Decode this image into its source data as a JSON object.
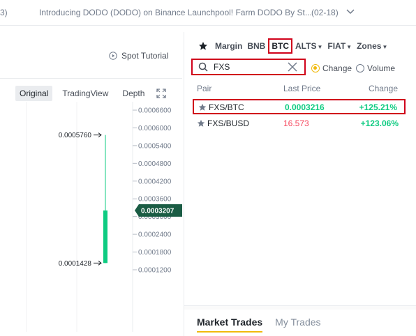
{
  "announcement": {
    "left_fragment": "3)",
    "text": "Introducing DODO (DODO) on Binance Launchpool! Farm DODO By St...",
    "date": "(02-18)"
  },
  "chart_panel": {
    "tutorial_label": "Spot Tutorial",
    "tabs": [
      {
        "label": "Original",
        "active": true
      },
      {
        "label": "TradingView",
        "active": false
      },
      {
        "label": "Depth",
        "active": false
      }
    ],
    "price_axis": [
      "0.0006600",
      "0.0006000",
      "0.0005400",
      "0.0004800",
      "0.0004200",
      "0.0003600",
      "0.0003000",
      "0.0002400",
      "0.0001800",
      "0.0001200"
    ],
    "high_label": "0.0005760",
    "low_label": "0.0001428",
    "current_price": "0.0003207",
    "candle": {
      "open": 0.0001428,
      "close": 0.0003207,
      "high": 0.000576,
      "low": 0.0001428
    },
    "colors": {
      "up": "#0ecb81",
      "current_tag": "#1a5c44"
    }
  },
  "market_panel": {
    "categories": [
      {
        "label": "Margin",
        "caret": false,
        "highlight": false
      },
      {
        "label": "BNB",
        "caret": false,
        "highlight": false
      },
      {
        "label": "BTC",
        "caret": false,
        "highlight": true
      },
      {
        "label": "ALTS",
        "caret": true,
        "highlight": false
      },
      {
        "label": "FIAT",
        "caret": true,
        "highlight": false
      },
      {
        "label": "Zones",
        "caret": true,
        "highlight": false
      }
    ],
    "search": {
      "value": "FXS",
      "placeholder": "Search"
    },
    "sort_options": [
      {
        "label": "Change",
        "selected": true
      },
      {
        "label": "Volume",
        "selected": false
      }
    ],
    "columns": {
      "pair": "Pair",
      "price": "Last Price",
      "change": "Change"
    },
    "rows": [
      {
        "pair": "FXS/BTC",
        "price": "0.0003216",
        "change": "+125.21%",
        "price_dir": "up",
        "highlight": true
      },
      {
        "pair": "FXS/BUSD",
        "price": "16.573",
        "change": "+123.06%",
        "price_dir": "down",
        "highlight": false
      }
    ],
    "trade_tabs": [
      {
        "label": "Market Trades",
        "active": true
      },
      {
        "label": "My Trades",
        "active": false
      }
    ],
    "colors": {
      "accent": "#f0b90b",
      "highlight_box": "#d0021b",
      "up": "#0ecb81",
      "down": "#f6465d"
    }
  }
}
